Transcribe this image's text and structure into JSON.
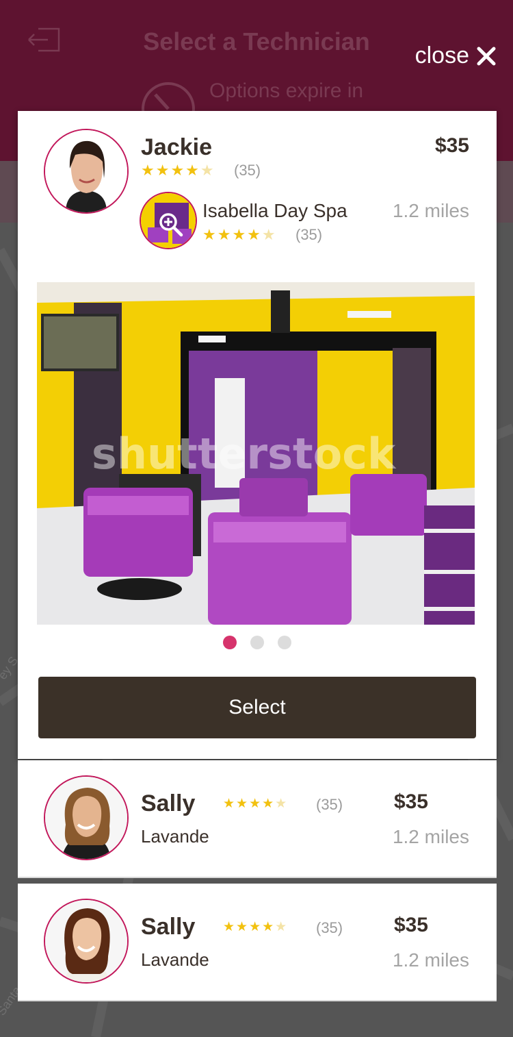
{
  "header": {
    "title": "Select a Technician",
    "expire_text": "Options expire in"
  },
  "close": {
    "label": "close"
  },
  "selected": {
    "name": "Jackie",
    "price": "$35",
    "rating_count": "(35)",
    "rating_stars": "★★★★",
    "rating_empty": "★",
    "spa": {
      "name": "Isabella Day Spa",
      "distance": "1.2 miles",
      "rating_count": "(35)",
      "rating_stars": "★★★★",
      "rating_empty": "★"
    },
    "photo_watermark": "shutterstock",
    "carousel": {
      "total": 3,
      "active": 1
    },
    "select_label": "Select"
  },
  "list": [
    {
      "name": "Sally",
      "subtitle": "Lavande",
      "price": "$35",
      "distance": "1.2 miles",
      "rating_count": "(35)",
      "rating_stars": "★★★★",
      "rating_empty": "★"
    },
    {
      "name": "Sally",
      "subtitle": "Lavande",
      "price": "$35",
      "distance": "1.2 miles",
      "rating_count": "(35)",
      "rating_stars": "★★★★",
      "rating_empty": "★"
    }
  ],
  "colors": {
    "brand": "#5e1330",
    "accent": "#c2185b",
    "star": "#f2c10f",
    "button": "#3b3128"
  }
}
